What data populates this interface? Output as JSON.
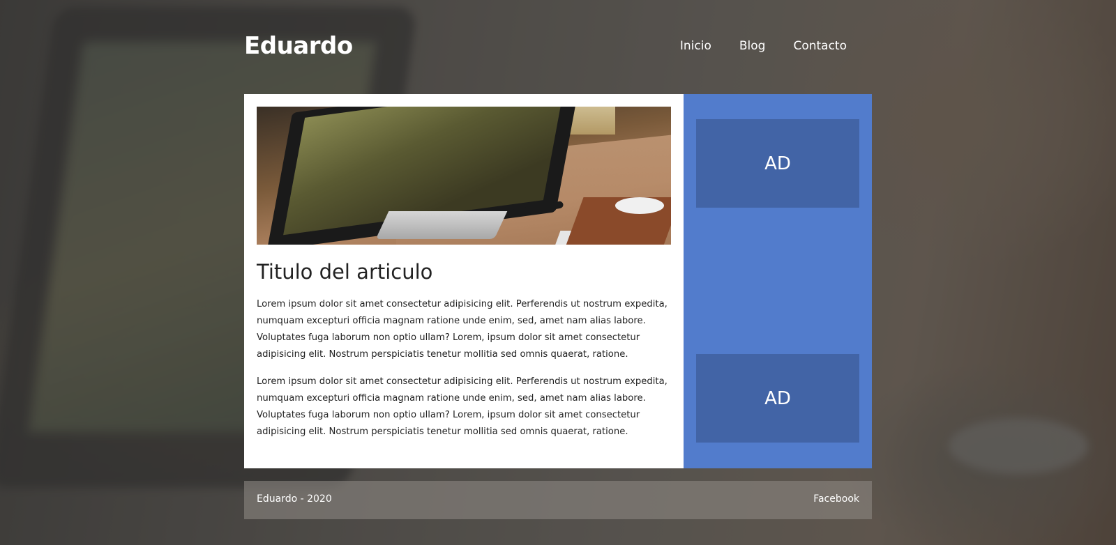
{
  "site": {
    "logo": "Eduardo"
  },
  "nav": {
    "items": [
      {
        "label": "Inicio"
      },
      {
        "label": "Blog"
      },
      {
        "label": "Contacto"
      }
    ]
  },
  "article": {
    "title": "Titulo del articulo",
    "paragraphs": [
      "Lorem ipsum dolor sit amet consectetur adipisicing elit. Perferendis ut nostrum expedita, numquam excepturi officia magnam ratione unde enim, sed, amet nam alias labore. Voluptates fuga laborum non optio ullam? Lorem, ipsum dolor sit amet consectetur adipisicing elit. Nostrum perspiciatis tenetur mollitia sed omnis quaerat, ratione.",
      "Lorem ipsum dolor sit amet consectetur adipisicing elit. Perferendis ut nostrum expedita, numquam excepturi officia magnam ratione unde enim, sed, amet nam alias labore. Voluptates fuga laborum non optio ullam? Lorem, ipsum dolor sit amet consectetur adipisicing elit. Nostrum perspiciatis tenetur mollitia sed omnis quaerat, ratione."
    ]
  },
  "sidebar": {
    "ads": [
      {
        "label": "AD"
      },
      {
        "label": "AD"
      }
    ]
  },
  "footer": {
    "copyright": "Eduardo - 2020",
    "social_link": "Facebook"
  },
  "colors": {
    "sidebar_bg": "#527ccc",
    "ad_bg": "#4264a6",
    "content_bg": "#ffffff",
    "text": "#222222"
  }
}
